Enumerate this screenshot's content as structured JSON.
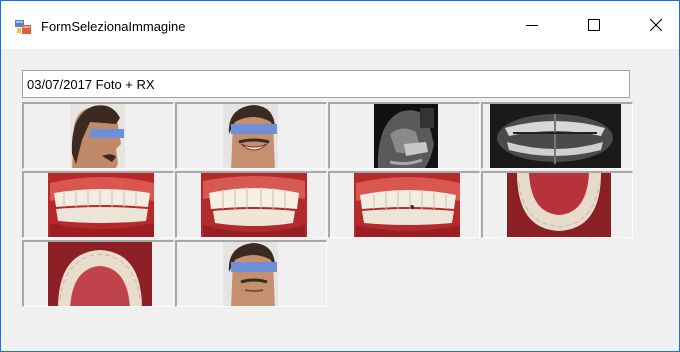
{
  "window": {
    "title": "FormSelezionaImmagine"
  },
  "caption": {
    "value": "03/07/2017 Foto + RX"
  },
  "thumbnails": [
    {
      "content": "profile-face-photo"
    },
    {
      "content": "frontal-smile-face-photo"
    },
    {
      "content": "cephalometric-xray"
    },
    {
      "content": "panoramic-xray"
    },
    {
      "content": "intraoral-right-lateral"
    },
    {
      "content": "intraoral-frontal"
    },
    {
      "content": "intraoral-left-lateral"
    },
    {
      "content": "intraoral-lower-occlusal"
    },
    {
      "content": "intraoral-upper-occlusal"
    },
    {
      "content": "frontal-face-photo"
    }
  ],
  "colors": {
    "window_border": "#1c6fd8",
    "privacy_bar": "#6f8fd9"
  }
}
